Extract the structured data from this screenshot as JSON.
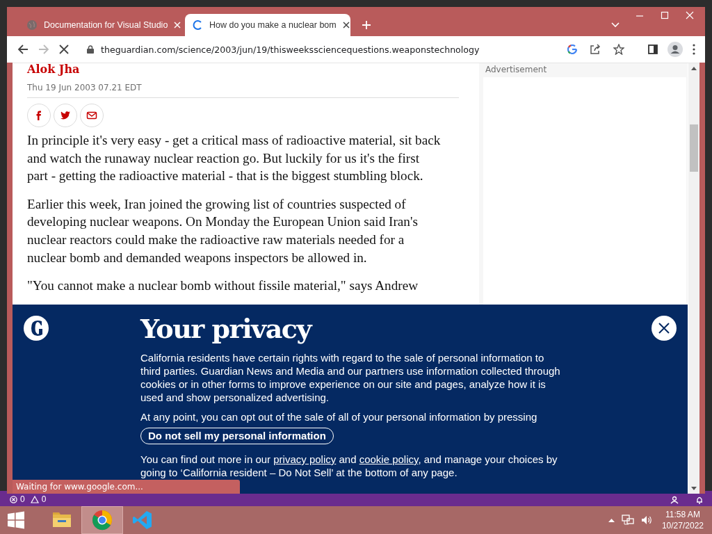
{
  "browser": {
    "tabs": [
      {
        "title": "Documentation for Visual Studio",
        "selected": false,
        "loading": false
      },
      {
        "title": "How do you make a nuclear bom",
        "selected": true,
        "loading": true
      }
    ],
    "toolbar": {
      "back_enabled": true,
      "forward_enabled": false,
      "loading": true,
      "url": "theguardian.com/science/2003/jun/19/thisweekssciencequestions.weaponstechnology"
    },
    "status_bubble": "Waiting for www.google.com..."
  },
  "article": {
    "author": "Alok Jha",
    "date": "Thu 19 Jun 2003 07.21 EDT",
    "paragraphs": [
      {
        "lines": [
          "In principle it's very easy - get a critical mass of radioactive material, sit back",
          "and watch the runaway nuclear reaction go. But luckily for us it's the first",
          "part - getting the radioactive material - that is the biggest stumbling block."
        ]
      },
      {
        "lines": [
          "Earlier this week, Iran joined the growing list of countries suspected of",
          "developing nuclear weapons. On Monday the European Union said Iran's",
          "nuclear reactors could make the radioactive raw materials needed for a",
          "nuclear bomb and demanded weapons inspectors be allowed in."
        ]
      },
      {
        "lines": [
          "\"You cannot make a nuclear bomb without fissile material,\" says Andrew"
        ]
      }
    ]
  },
  "sidebar": {
    "ad_label": "Advertisement"
  },
  "privacy_banner": {
    "title": "Your privacy",
    "paragraphs": [
      "California residents have certain rights with regard to the sale of personal information to third parties. Guardian News and Media and our partners use information collected through cookies or in other forms to improve experience on our site and pages, analyze how it is used and show personalized advertising.",
      "At any point, you can opt out of the sale of all of your personal information by pressing"
    ],
    "button": "Do not sell my personal information",
    "footer": [
      {
        "kind": "text",
        "text": "You can find out more in our "
      },
      {
        "kind": "link",
        "text": "privacy policy"
      },
      {
        "kind": "text",
        "text": " and "
      },
      {
        "kind": "link",
        "text": "cookie policy"
      },
      {
        "kind": "text",
        "text": ", and manage your choices by going to ‘California resident – Do Not Sell’ at the bottom of any page."
      }
    ]
  },
  "editor_status": {
    "errors": "0",
    "warnings": "0"
  },
  "taskbar": {
    "apps": [
      {
        "kind": "explorer",
        "selected": false
      },
      {
        "kind": "chrome",
        "selected": true
      },
      {
        "kind": "vscode",
        "selected": false
      }
    ],
    "time": "11:58 AM",
    "date": "10/27/2022"
  }
}
